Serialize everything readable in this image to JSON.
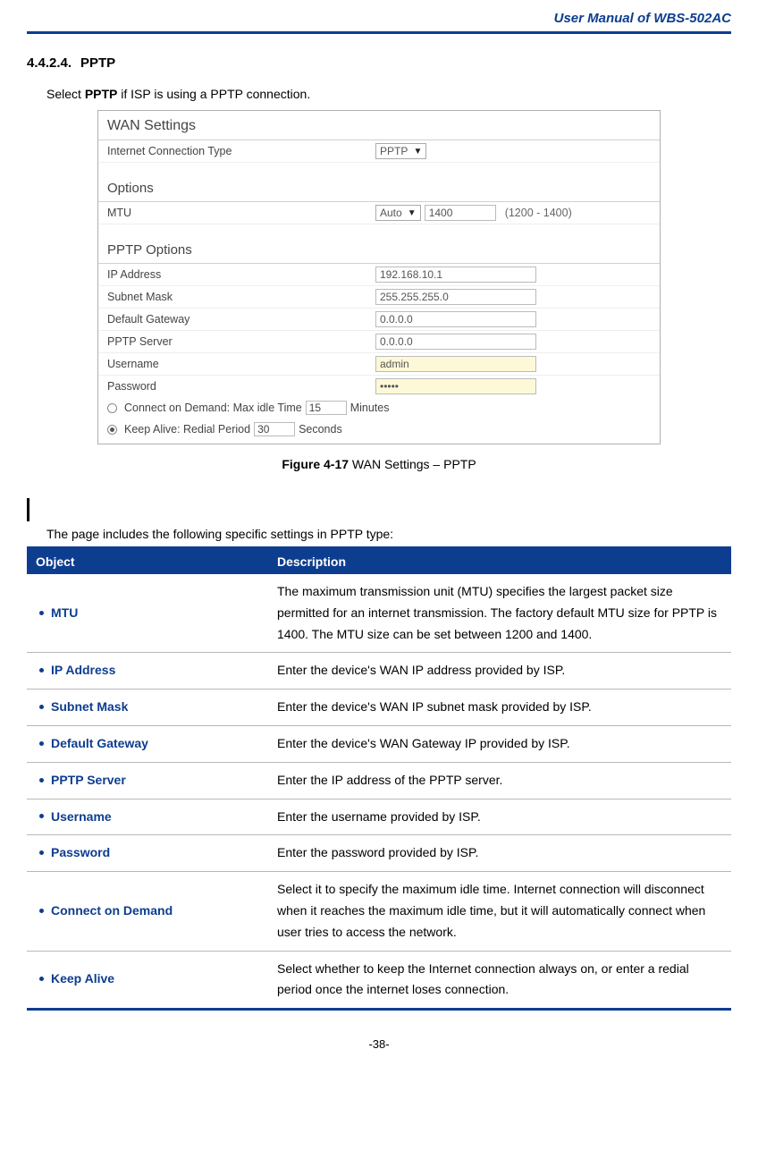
{
  "header": {
    "title": "User  Manual  of  WBS-502AC"
  },
  "section": {
    "number": "4.4.2.4.",
    "title": "PPTP",
    "intro_pre": "Select ",
    "intro_bold": "PPTP",
    "intro_post": " if ISP is using a PPTP connection."
  },
  "screenshot": {
    "wan_title": "WAN Settings",
    "conn_type_label": "Internet Connection Type",
    "conn_type_value": "PPTP",
    "options_title": "Options",
    "mtu_label": "MTU",
    "mtu_mode": "Auto",
    "mtu_value": "1400",
    "mtu_hint": "(1200 - 1400)",
    "pptp_options_title": "PPTP Options",
    "rows": {
      "ip_label": "IP Address",
      "ip_value": "192.168.10.1",
      "mask_label": "Subnet Mask",
      "mask_value": "255.255.255.0",
      "gw_label": "Default Gateway",
      "gw_value": "0.0.0.0",
      "srv_label": "PPTP Server",
      "srv_value": "0.0.0.0",
      "user_label": "Username",
      "user_value": "admin",
      "pass_label": "Password",
      "pass_value": "•••••"
    },
    "cod_label_pre": "Connect on Demand:  Max idle Time",
    "cod_value": "15",
    "cod_unit": "Minutes",
    "ka_label_pre": "Keep Alive:  Redial Period",
    "ka_value": "30",
    "ka_unit": "Seconds"
  },
  "figure": {
    "bold": "Figure 4-17",
    "rest": " WAN Settings – PPTP"
  },
  "table_intro": "The page includes the following specific settings in PPTP type:",
  "table": {
    "head_obj": "Object",
    "head_desc": "Description",
    "rows": [
      {
        "obj": "MTU",
        "desc": "The maximum transmission unit (MTU) specifies the largest packet size permitted for an internet transmission. The factory default MTU size for PPTP is 1400. The MTU size can be set between 1200 and 1400."
      },
      {
        "obj": "IP Address",
        "desc": "Enter the device's WAN IP address provided by ISP."
      },
      {
        "obj": "Subnet Mask",
        "desc": "Enter the device's WAN IP subnet mask provided by ISP."
      },
      {
        "obj": "Default Gateway",
        "desc": "Enter the device's WAN Gateway IP provided by ISP."
      },
      {
        "obj": "PPTP Server",
        "desc": "Enter the IP address of the PPTP server."
      },
      {
        "obj": "Username",
        "desc": "Enter the username provided by ISP."
      },
      {
        "obj": "Password",
        "desc": "Enter the password provided by ISP."
      },
      {
        "obj": "Connect on Demand",
        "desc": "Select it to specify the maximum idle time. Internet connection will disconnect when it reaches the maximum idle time, but it will automatically connect when user tries to access the network."
      },
      {
        "obj": "Keep Alive",
        "desc": "Select whether to keep the Internet connection always on, or enter a redial period once the internet loses connection."
      }
    ]
  },
  "footer": {
    "page": "-38-"
  }
}
